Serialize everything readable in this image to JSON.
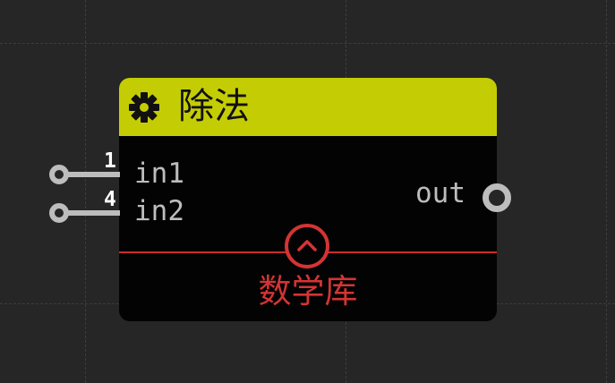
{
  "node": {
    "title": "除法",
    "category": "数学库",
    "header_color": "#c4cd04",
    "accent_color": "#d43434",
    "icons": {
      "header": "gear-icon",
      "collapse": "chevron-up-icon"
    },
    "inputs": [
      {
        "label": "in1",
        "value": "1"
      },
      {
        "label": "in2",
        "value": "4"
      }
    ],
    "outputs": [
      {
        "label": "out"
      }
    ]
  }
}
